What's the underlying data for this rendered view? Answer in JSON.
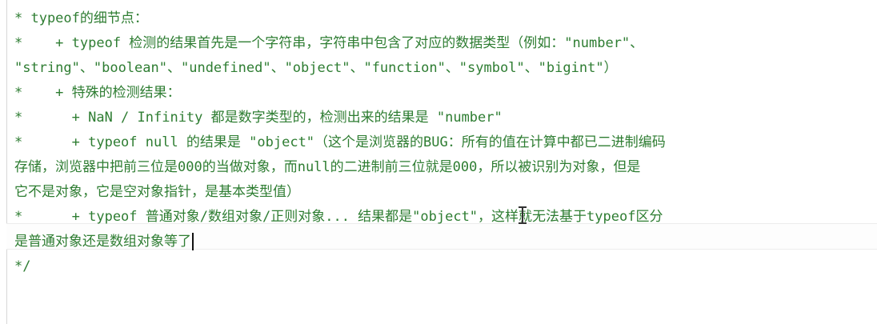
{
  "lines": [
    "* typeof的细节点：",
    "*    + typeof 检测的结果首先是一个字符串，字符串中包含了对应的数据类型（例如：\"number\"、",
    "\"string\"、\"boolean\"、\"undefined\"、\"object\"、\"function\"、\"symbol\"、\"bigint\"）",
    "*    + 特殊的检测结果：",
    "*      + NaN / Infinity 都是数字类型的，检测出来的结果是 \"number\"",
    "*      + typeof null 的结果是 \"object\"（这个是浏览器的BUG：所有的值在计算中都已二进制编码",
    "存储，浏览器中把前三位是000的当做对象，而null的二进制前三位就是000，所以被识别为对象，但是",
    "它不是对象，它是空对象指针，是基本类型值）",
    "*      + typeof 普通对象/数组对象/正则对象... 结果都是\"object\"，这样就无法基于typeof区分",
    "是普通对象还是数组对象等了",
    "*/"
  ]
}
